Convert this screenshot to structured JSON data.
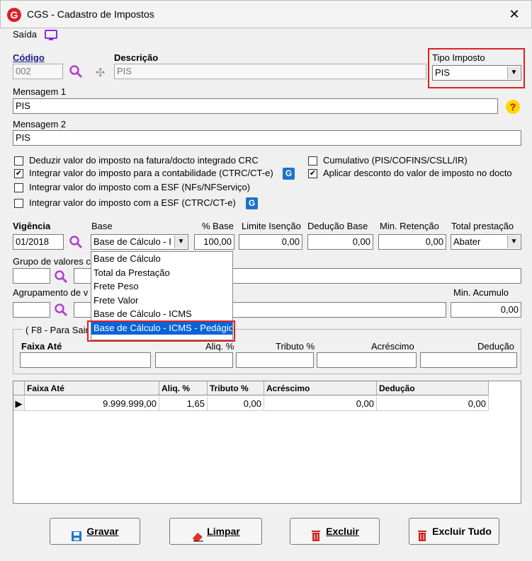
{
  "window": {
    "title": "CGS - Cadastro de Impostos",
    "logo": "G",
    "close": "✕"
  },
  "toolbar": {
    "exit_label": "Saída"
  },
  "fields": {
    "codigo_label": "Código",
    "codigo_value": "002",
    "descricao_label": "Descrição",
    "descricao_value": "PIS",
    "tipo_label": "Tipo Imposto",
    "tipo_value": "PIS",
    "msg1_label": "Mensagem 1",
    "msg1_value": "PIS",
    "msg2_label": "Mensagem 2",
    "msg2_value": "PIS"
  },
  "checkboxes": [
    {
      "label": "Deduzir valor do imposto na fatura/docto integrado CRC",
      "checked": false
    },
    {
      "label": "Integrar valor do imposto para a contabilidade (CTRC/CT-e)",
      "checked": true
    },
    {
      "label": "Integrar valor do imposto com a ESF (NFs/NFServiço)",
      "checked": false
    },
    {
      "label": "Integrar valor do imposto com a ESF (CTRC/CT-e)",
      "checked": false
    },
    {
      "label": "Cumulativo (PIS/COFINS/CSLL/IR)",
      "checked": false
    },
    {
      "label": "Aplicar desconto do valor de imposto no docto",
      "checked": true
    }
  ],
  "vigencia": {
    "vigencia_label": "Vigência",
    "vigencia_value": "01/2018",
    "base_label": "Base",
    "base_value": "Base de Cálculo - I",
    "pct_base_label": "% Base",
    "pct_base_value": "100,00",
    "limite_label": "Limite Isenção",
    "limite_value": "0,00",
    "deducao_label": "Dedução Base",
    "deducao_value": "0,00",
    "min_ret_label": "Min. Retenção",
    "min_ret_value": "0,00",
    "total_label": "Total prestação",
    "total_value": "Abater"
  },
  "base_options": [
    "Base de Cálculo",
    "Total da Prestação",
    "Frete Peso",
    "Frete Valor",
    "Base de Cálculo - ICMS",
    "Base de Cálculo - ICMS - Pedágio"
  ],
  "grupo": {
    "label": "Grupo de valores c"
  },
  "agrupamento": {
    "label": "Agrupamento de v",
    "min_acumulo_label": "Min. Acumulo",
    "min_acumulo_value": "0,00"
  },
  "faixa": {
    "group_label": "( F8 - Para Sair",
    "faixa_label": "Faixa Até",
    "aliq_label": "Aliq. %",
    "tributo_label": "Tributo %",
    "acrescimo_label": "Acréscimo",
    "deducao_label": "Dedução"
  },
  "grid": {
    "headers": [
      "Faixa Até",
      "Aliq. %",
      "Tributo %",
      "Acréscimo",
      "Dedução"
    ],
    "row": [
      "9.999.999,00",
      "1,65",
      "0,00",
      "0,00",
      "0,00"
    ],
    "row_marker": "▶"
  },
  "buttons": {
    "gravar": "Gravar",
    "limpar": "Limpar",
    "excluir": "Excluir",
    "excluir_tudo": "Excluir Tudo"
  },
  "colors": {
    "accent": "#0a64d8",
    "highlight": "#e02020",
    "logo": "#d9202a"
  }
}
